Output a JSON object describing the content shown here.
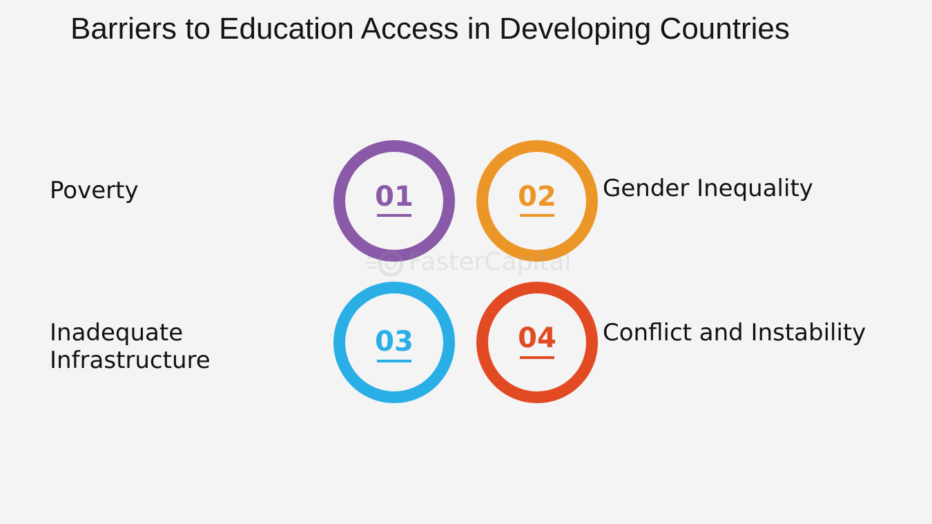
{
  "title": "Barriers to Education Access in Developing Countries",
  "items": [
    {
      "number": "01",
      "label": "Poverty",
      "color": "#8a5aa8"
    },
    {
      "number": "02",
      "label": "Gender Inequality",
      "color": "#ec9628"
    },
    {
      "number": "03",
      "label": "Inadequate\nInfrastructure",
      "color": "#2aaee6"
    },
    {
      "number": "04",
      "label": "Conflict and Instability",
      "color": "#e24a24"
    }
  ],
  "watermark": {
    "text": "FasterCapital",
    "icon": "gear-logo-icon"
  }
}
